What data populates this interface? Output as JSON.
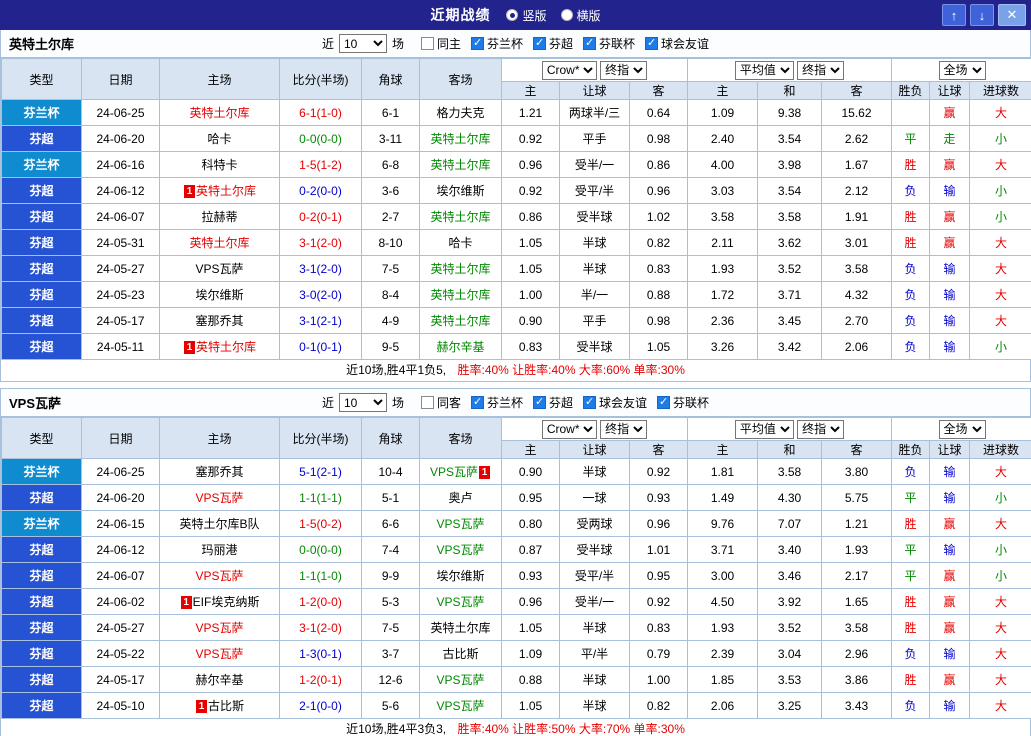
{
  "topbar": {
    "title": "近期战绩",
    "view_options": [
      {
        "label": "竖版",
        "selected": true
      },
      {
        "label": "横版",
        "selected": false
      }
    ],
    "up_icon": "↑",
    "down_icon": "↓",
    "close_icon": "✕"
  },
  "colors": {
    "win": "#e60000",
    "draw": "#008a00",
    "loss": "#0000d0",
    "league_finnish_cup": "#0f8cd0",
    "league_veikkausliiga": "#2653d4",
    "topbar": "#23238e"
  },
  "table_header": {
    "type": "类型",
    "date": "日期",
    "home": "主场",
    "score": "比分(半场)",
    "corner": "角球",
    "away": "客场",
    "book_select": "Crow*",
    "book_time_select": "终指",
    "avg_select": "平均值",
    "avg_time_select": "终指",
    "fulltime_select": "全场",
    "sub_home": "主",
    "sub_handicap": "让球",
    "sub_away": "客",
    "sub_avg_home": "主",
    "sub_avg_draw": "和",
    "sub_avg_away": "客",
    "sub_wl": "胜负",
    "sub_let": "让球",
    "sub_goals": "进球数"
  },
  "sections": [
    {
      "team": "英特土尔库",
      "recent_prefix": "近",
      "recent_count": "10",
      "recent_suffix": "场",
      "filters": [
        {
          "label": "同主",
          "checked": false
        },
        {
          "label": "芬兰杯",
          "checked": true
        },
        {
          "label": "芬超",
          "checked": true
        },
        {
          "label": "芬联杯",
          "checked": true
        },
        {
          "label": "球会友谊",
          "checked": true
        }
      ],
      "rows": [
        {
          "league": "芬兰杯",
          "league_cls": "cup",
          "date": "24-06-25",
          "home_badge": "",
          "home": "英特土尔库",
          "home_cls": "t-red",
          "score": "6-1(1-0)",
          "score_cls": "t-red",
          "corner": "6-1",
          "away": "格力夫克",
          "away_cls": "",
          "away_badge": "",
          "odds_home": "1.21",
          "odds_handicap": "两球半/三",
          "odds_away": "0.64",
          "avg_home": "1.09",
          "avg_draw": "9.38",
          "avg_away": "15.62",
          "wl": "",
          "wl_cls": "",
          "hc": "赢",
          "hc_cls": "t-red",
          "goal": "大",
          "goal_cls": "t-red"
        },
        {
          "league": "芬超",
          "league_cls": "super",
          "date": "24-06-20",
          "home_badge": "",
          "home": "哈卡",
          "home_cls": "",
          "score": "0-0(0-0)",
          "score_cls": "t-green",
          "corner": "3-11",
          "away": "英特土尔库",
          "away_cls": "t-green",
          "away_badge": "",
          "odds_home": "0.92",
          "odds_handicap": "平手",
          "odds_away": "0.98",
          "avg_home": "2.40",
          "avg_draw": "3.54",
          "avg_away": "2.62",
          "wl": "平",
          "wl_cls": "t-green",
          "hc": "走",
          "hc_cls": "t-green",
          "goal": "小",
          "goal_cls": "t-green"
        },
        {
          "league": "芬兰杯",
          "league_cls": "cup",
          "date": "24-06-16",
          "home_badge": "",
          "home": "科特卡",
          "home_cls": "",
          "score": "1-5(1-2)",
          "score_cls": "t-red",
          "corner": "6-8",
          "away": "英特土尔库",
          "away_cls": "t-green",
          "away_badge": "",
          "odds_home": "0.96",
          "odds_handicap": "受半/一",
          "odds_away": "0.86",
          "avg_home": "4.00",
          "avg_draw": "3.98",
          "avg_away": "1.67",
          "wl": "胜",
          "wl_cls": "t-red",
          "hc": "赢",
          "hc_cls": "t-red",
          "goal": "大",
          "goal_cls": "t-red"
        },
        {
          "league": "芬超",
          "league_cls": "super",
          "date": "24-06-12",
          "home_badge": "1",
          "home": "英特土尔库",
          "home_cls": "t-red",
          "score": "0-2(0-0)",
          "score_cls": "t-blue",
          "corner": "3-6",
          "away": "埃尔维斯",
          "away_cls": "",
          "away_badge": "",
          "odds_home": "0.92",
          "odds_handicap": "受平/半",
          "odds_away": "0.96",
          "avg_home": "3.03",
          "avg_draw": "3.54",
          "avg_away": "2.12",
          "wl": "负",
          "wl_cls": "t-blue",
          "hc": "输",
          "hc_cls": "t-blue",
          "goal": "小",
          "goal_cls": "t-green"
        },
        {
          "league": "芬超",
          "league_cls": "super",
          "date": "24-06-07",
          "home_badge": "",
          "home": "拉赫蒂",
          "home_cls": "",
          "score": "0-2(0-1)",
          "score_cls": "t-red",
          "corner": "2-7",
          "away": "英特土尔库",
          "away_cls": "t-green",
          "away_badge": "",
          "odds_home": "0.86",
          "odds_handicap": "受半球",
          "odds_away": "1.02",
          "avg_home": "3.58",
          "avg_draw": "3.58",
          "avg_away": "1.91",
          "wl": "胜",
          "wl_cls": "t-red",
          "hc": "赢",
          "hc_cls": "t-red",
          "goal": "小",
          "goal_cls": "t-green"
        },
        {
          "league": "芬超",
          "league_cls": "super",
          "date": "24-05-31",
          "home_badge": "",
          "home": "英特土尔库",
          "home_cls": "t-red",
          "score": "3-1(2-0)",
          "score_cls": "t-red",
          "corner": "8-10",
          "away": "哈卡",
          "away_cls": "",
          "away_badge": "",
          "odds_home": "1.05",
          "odds_handicap": "半球",
          "odds_away": "0.82",
          "avg_home": "2.11",
          "avg_draw": "3.62",
          "avg_away": "3.01",
          "wl": "胜",
          "wl_cls": "t-red",
          "hc": "赢",
          "hc_cls": "t-red",
          "goal": "大",
          "goal_cls": "t-red"
        },
        {
          "league": "芬超",
          "league_cls": "super",
          "date": "24-05-27",
          "home_badge": "",
          "home": "VPS瓦萨",
          "home_cls": "",
          "score": "3-1(2-0)",
          "score_cls": "t-blue",
          "corner": "7-5",
          "away": "英特土尔库",
          "away_cls": "t-green",
          "away_badge": "",
          "odds_home": "1.05",
          "odds_handicap": "半球",
          "odds_away": "0.83",
          "avg_home": "1.93",
          "avg_draw": "3.52",
          "avg_away": "3.58",
          "wl": "负",
          "wl_cls": "t-blue",
          "hc": "输",
          "hc_cls": "t-blue",
          "goal": "大",
          "goal_cls": "t-red"
        },
        {
          "league": "芬超",
          "league_cls": "super",
          "date": "24-05-23",
          "home_badge": "",
          "home": "埃尔维斯",
          "home_cls": "",
          "score": "3-0(2-0)",
          "score_cls": "t-blue",
          "corner": "8-4",
          "away": "英特土尔库",
          "away_cls": "t-green",
          "away_badge": "",
          "odds_home": "1.00",
          "odds_handicap": "半/一",
          "odds_away": "0.88",
          "avg_home": "1.72",
          "avg_draw": "3.71",
          "avg_away": "4.32",
          "wl": "负",
          "wl_cls": "t-blue",
          "hc": "输",
          "hc_cls": "t-blue",
          "goal": "大",
          "goal_cls": "t-red"
        },
        {
          "league": "芬超",
          "league_cls": "super",
          "date": "24-05-17",
          "home_badge": "",
          "home": "塞那乔其",
          "home_cls": "",
          "score": "3-1(2-1)",
          "score_cls": "t-blue",
          "corner": "4-9",
          "away": "英特土尔库",
          "away_cls": "t-green",
          "away_badge": "",
          "odds_home": "0.90",
          "odds_handicap": "平手",
          "odds_away": "0.98",
          "avg_home": "2.36",
          "avg_draw": "3.45",
          "avg_away": "2.70",
          "wl": "负",
          "wl_cls": "t-blue",
          "hc": "输",
          "hc_cls": "t-blue",
          "goal": "大",
          "goal_cls": "t-red"
        },
        {
          "league": "芬超",
          "league_cls": "super",
          "date": "24-05-11",
          "home_badge": "1",
          "home": "英特土尔库",
          "home_cls": "t-red",
          "score": "0-1(0-1)",
          "score_cls": "t-blue",
          "corner": "9-5",
          "away": "赫尔辛基",
          "away_cls": "t-green",
          "away_badge": "",
          "odds_home": "0.83",
          "odds_handicap": "受半球",
          "odds_away": "1.05",
          "avg_home": "3.26",
          "avg_draw": "3.42",
          "avg_away": "2.06",
          "wl": "负",
          "wl_cls": "t-blue",
          "hc": "输",
          "hc_cls": "t-blue",
          "goal": "小",
          "goal_cls": "t-green"
        }
      ],
      "summary_prefix": "近10场,胜4平1负5,",
      "summary_stats": "胜率:40% 让胜率:40% 大率:60% 单率:30%"
    },
    {
      "team": "VPS瓦萨",
      "recent_prefix": "近",
      "recent_count": "10",
      "recent_suffix": "场",
      "filters": [
        {
          "label": "同客",
          "checked": false
        },
        {
          "label": "芬兰杯",
          "checked": true
        },
        {
          "label": "芬超",
          "checked": true
        },
        {
          "label": "球会友谊",
          "checked": true
        },
        {
          "label": "芬联杯",
          "checked": true
        }
      ],
      "rows": [
        {
          "league": "芬兰杯",
          "league_cls": "cup",
          "date": "24-06-25",
          "home_badge": "",
          "home": "塞那乔其",
          "home_cls": "",
          "score": "5-1(2-1)",
          "score_cls": "t-blue",
          "corner": "10-4",
          "away": "VPS瓦萨",
          "away_cls": "t-green",
          "away_badge": "1",
          "odds_home": "0.90",
          "odds_handicap": "半球",
          "odds_away": "0.92",
          "avg_home": "1.81",
          "avg_draw": "3.58",
          "avg_away": "3.80",
          "wl": "负",
          "wl_cls": "t-blue",
          "hc": "输",
          "hc_cls": "t-blue",
          "goal": "大",
          "goal_cls": "t-red"
        },
        {
          "league": "芬超",
          "league_cls": "super",
          "date": "24-06-20",
          "home_badge": "",
          "home": "VPS瓦萨",
          "home_cls": "t-red",
          "score": "1-1(1-1)",
          "score_cls": "t-green",
          "corner": "5-1",
          "away": "奥卢",
          "away_cls": "",
          "away_badge": "",
          "odds_home": "0.95",
          "odds_handicap": "一球",
          "odds_away": "0.93",
          "avg_home": "1.49",
          "avg_draw": "4.30",
          "avg_away": "5.75",
          "wl": "平",
          "wl_cls": "t-green",
          "hc": "输",
          "hc_cls": "t-blue",
          "goal": "小",
          "goal_cls": "t-green"
        },
        {
          "league": "芬兰杯",
          "league_cls": "cup",
          "date": "24-06-15",
          "home_badge": "",
          "home": "英特土尔库B队",
          "home_cls": "",
          "score": "1-5(0-2)",
          "score_cls": "t-red",
          "corner": "6-6",
          "away": "VPS瓦萨",
          "away_cls": "t-green",
          "away_badge": "",
          "odds_home": "0.80",
          "odds_handicap": "受两球",
          "odds_away": "0.96",
          "avg_home": "9.76",
          "avg_draw": "7.07",
          "avg_away": "1.21",
          "wl": "胜",
          "wl_cls": "t-red",
          "hc": "赢",
          "hc_cls": "t-red",
          "goal": "大",
          "goal_cls": "t-red"
        },
        {
          "league": "芬超",
          "league_cls": "super",
          "date": "24-06-12",
          "home_badge": "",
          "home": "玛丽港",
          "home_cls": "",
          "score": "0-0(0-0)",
          "score_cls": "t-green",
          "corner": "7-4",
          "away": "VPS瓦萨",
          "away_cls": "t-green",
          "away_badge": "",
          "odds_home": "0.87",
          "odds_handicap": "受半球",
          "odds_away": "1.01",
          "avg_home": "3.71",
          "avg_draw": "3.40",
          "avg_away": "1.93",
          "wl": "平",
          "wl_cls": "t-green",
          "hc": "输",
          "hc_cls": "t-blue",
          "goal": "小",
          "goal_cls": "t-green"
        },
        {
          "league": "芬超",
          "league_cls": "super",
          "date": "24-06-07",
          "home_badge": "",
          "home": "VPS瓦萨",
          "home_cls": "t-red",
          "score": "1-1(1-0)",
          "score_cls": "t-green",
          "corner": "9-9",
          "away": "埃尔维斯",
          "away_cls": "",
          "away_badge": "",
          "odds_home": "0.93",
          "odds_handicap": "受平/半",
          "odds_away": "0.95",
          "avg_home": "3.00",
          "avg_draw": "3.46",
          "avg_away": "2.17",
          "wl": "平",
          "wl_cls": "t-green",
          "hc": "赢",
          "hc_cls": "t-red",
          "goal": "小",
          "goal_cls": "t-green"
        },
        {
          "league": "芬超",
          "league_cls": "super",
          "date": "24-06-02",
          "home_badge": "1",
          "home": "EIF埃克纳斯",
          "home_cls": "",
          "score": "1-2(0-0)",
          "score_cls": "t-red",
          "corner": "5-3",
          "away": "VPS瓦萨",
          "away_cls": "t-green",
          "away_badge": "",
          "odds_home": "0.96",
          "odds_handicap": "受半/一",
          "odds_away": "0.92",
          "avg_home": "4.50",
          "avg_draw": "3.92",
          "avg_away": "1.65",
          "wl": "胜",
          "wl_cls": "t-red",
          "hc": "赢",
          "hc_cls": "t-red",
          "goal": "大",
          "goal_cls": "t-red"
        },
        {
          "league": "芬超",
          "league_cls": "super",
          "date": "24-05-27",
          "home_badge": "",
          "home": "VPS瓦萨",
          "home_cls": "t-red",
          "score": "3-1(2-0)",
          "score_cls": "t-red",
          "corner": "7-5",
          "away": "英特土尔库",
          "away_cls": "",
          "away_badge": "",
          "odds_home": "1.05",
          "odds_handicap": "半球",
          "odds_away": "0.83",
          "avg_home": "1.93",
          "avg_draw": "3.52",
          "avg_away": "3.58",
          "wl": "胜",
          "wl_cls": "t-red",
          "hc": "赢",
          "hc_cls": "t-red",
          "goal": "大",
          "goal_cls": "t-red"
        },
        {
          "league": "芬超",
          "league_cls": "super",
          "date": "24-05-22",
          "home_badge": "",
          "home": "VPS瓦萨",
          "home_cls": "t-red",
          "score": "1-3(0-1)",
          "score_cls": "t-blue",
          "corner": "3-7",
          "away": "古比斯",
          "away_cls": "",
          "away_badge": "",
          "odds_home": "1.09",
          "odds_handicap": "平/半",
          "odds_away": "0.79",
          "avg_home": "2.39",
          "avg_draw": "3.04",
          "avg_away": "2.96",
          "wl": "负",
          "wl_cls": "t-blue",
          "hc": "输",
          "hc_cls": "t-blue",
          "goal": "大",
          "goal_cls": "t-red"
        },
        {
          "league": "芬超",
          "league_cls": "super",
          "date": "24-05-17",
          "home_badge": "",
          "home": "赫尔辛基",
          "home_cls": "",
          "score": "1-2(0-1)",
          "score_cls": "t-red",
          "corner": "12-6",
          "away": "VPS瓦萨",
          "away_cls": "t-green",
          "away_badge": "",
          "odds_home": "0.88",
          "odds_handicap": "半球",
          "odds_away": "1.00",
          "avg_home": "1.85",
          "avg_draw": "3.53",
          "avg_away": "3.86",
          "wl": "胜",
          "wl_cls": "t-red",
          "hc": "赢",
          "hc_cls": "t-red",
          "goal": "大",
          "goal_cls": "t-red"
        },
        {
          "league": "芬超",
          "league_cls": "super",
          "date": "24-05-10",
          "home_badge": "1",
          "home": "古比斯",
          "home_cls": "",
          "score": "2-1(0-0)",
          "score_cls": "t-blue",
          "corner": "5-6",
          "away": "VPS瓦萨",
          "away_cls": "t-green",
          "away_badge": "",
          "odds_home": "1.05",
          "odds_handicap": "半球",
          "odds_away": "0.82",
          "avg_home": "2.06",
          "avg_draw": "3.25",
          "avg_away": "3.43",
          "wl": "负",
          "wl_cls": "t-blue",
          "hc": "输",
          "hc_cls": "t-blue",
          "goal": "大",
          "goal_cls": "t-red"
        }
      ],
      "summary_prefix": "近10场,胜4平3负3,",
      "summary_stats": "胜率:40% 让胜率:50% 大率:70% 单率:30%"
    }
  ]
}
